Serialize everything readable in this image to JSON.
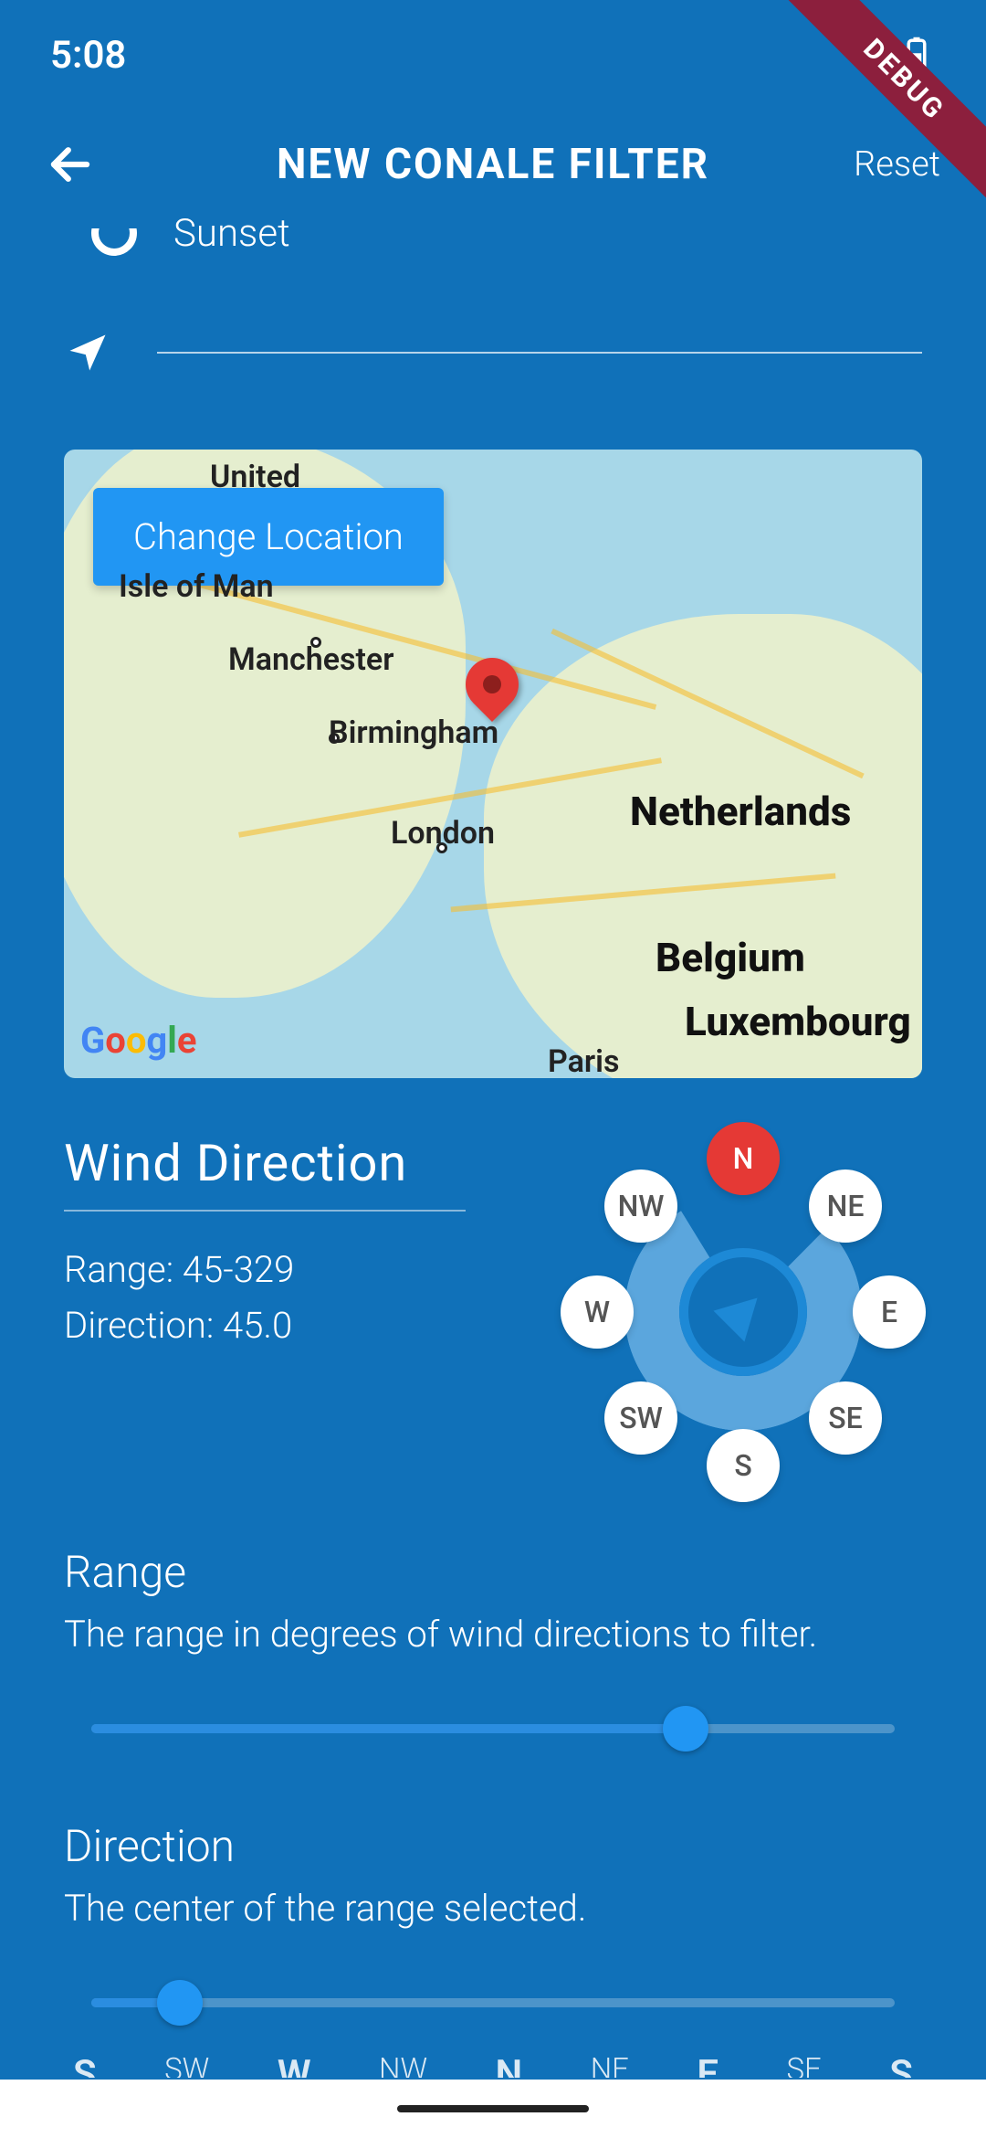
{
  "status": {
    "time": "5:08"
  },
  "debug_banner": "DEBUG",
  "appbar": {
    "title": "NEW CONALE FILTER",
    "reset": "Reset"
  },
  "radio_cut": {
    "label": "Sunset"
  },
  "map": {
    "change_button": "Change Location",
    "cities": [
      "United",
      "Isle of Man",
      "Manchester",
      "Birmingham",
      "London",
      "Paris"
    ],
    "countries": [
      "Netherlands",
      "Belgium",
      "Luxembourg"
    ],
    "attribution": "Google"
  },
  "wind": {
    "title": "Wind Direction",
    "range_label": "Range: 45-329",
    "direction_label": "Direction: 45.0",
    "directions": [
      "N",
      "NE",
      "E",
      "SE",
      "S",
      "SW",
      "W",
      "NW"
    ],
    "active": "N"
  },
  "range_section": {
    "title": "Range",
    "desc": "The range in degrees of wind directions to filter.",
    "value_pct": 74
  },
  "direction_section": {
    "title": "Direction",
    "desc": "The center of the range selected.",
    "value_pct": 11,
    "ticks": [
      "S",
      "SW",
      "W",
      "NW",
      "N",
      "NE",
      "E",
      "SE",
      "S"
    ]
  },
  "chart_data": {
    "type": "compass-range",
    "direction_deg": 45.0,
    "range_start_deg": 45,
    "range_end_deg": 329,
    "range_span_deg": 284,
    "slider_range_pct": 74,
    "slider_direction_pct": 11,
    "cardinal_points": [
      "N",
      "NE",
      "E",
      "SE",
      "S",
      "SW",
      "W",
      "NW"
    ]
  }
}
